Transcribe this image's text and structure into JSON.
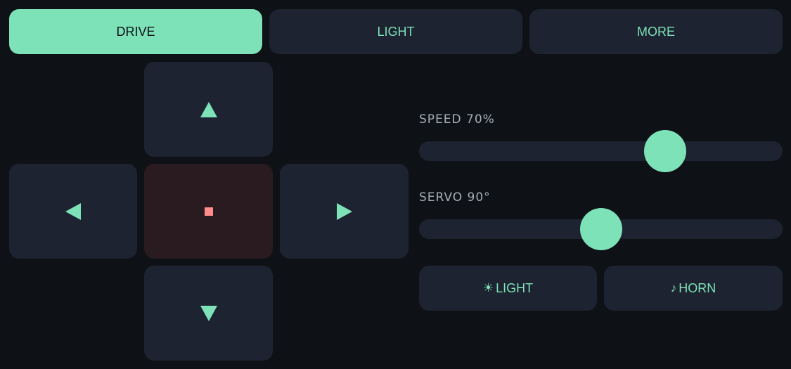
{
  "tabs": [
    {
      "label": "DRIVE",
      "active": true
    },
    {
      "label": "LIGHT",
      "active": false
    },
    {
      "label": "MORE",
      "active": false
    }
  ],
  "speed": {
    "label": "SPEED 70%",
    "value_percent": 70
  },
  "servo": {
    "label": "SERVO 90°",
    "value_degrees": 90,
    "max_degrees": 180
  },
  "actions": {
    "light": {
      "icon": "☀",
      "label": "LIGHT"
    },
    "horn": {
      "icon": "♪",
      "label": "HORN"
    }
  },
  "colors": {
    "accent": "#7ee2b8",
    "background": "#0e1116",
    "panel": "#1d2330",
    "stop_panel": "#2a1b20",
    "stop_icon": "#ff8b8b",
    "label": "#a7adb8"
  }
}
